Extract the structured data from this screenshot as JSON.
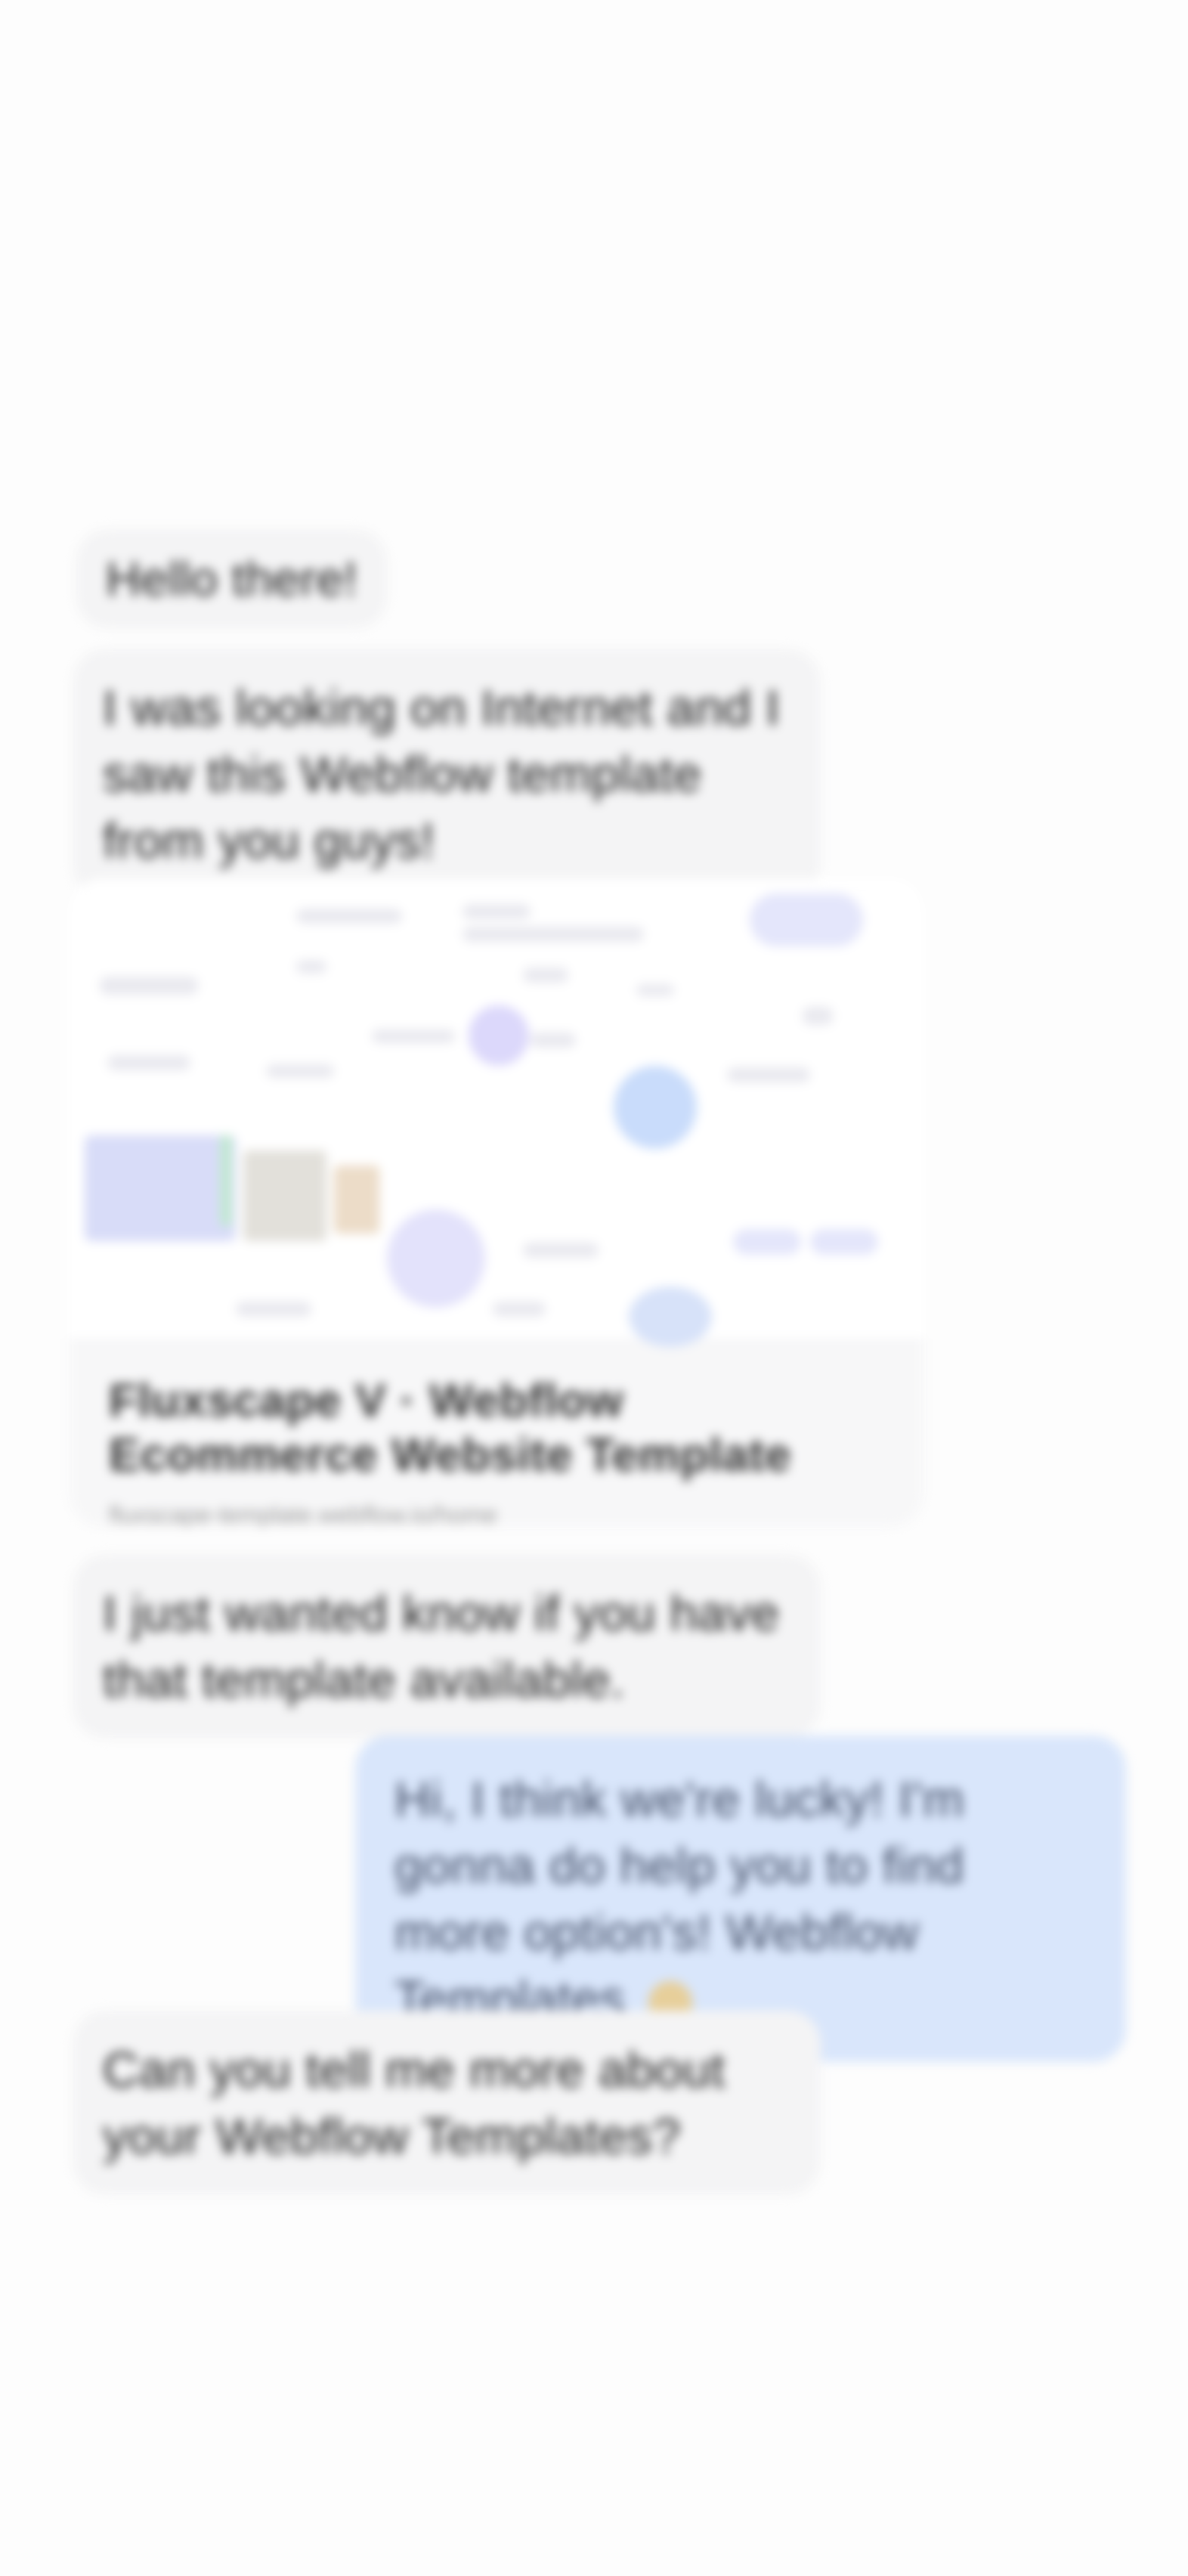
{
  "conversation": {
    "greeting": "Hello there!",
    "intro": "I was looking on Internet and I saw this Webflow template from you guys!",
    "link_card": {
      "title": "Fluxscape V · Webflow Ecommerce Website Template",
      "source": "fluxscape-template.webflow.io/home"
    },
    "follow_up": "I just wanted know if you have that template available.",
    "reply": "Hi, I think we're lucky! I'm gonna do help you to find more option's! Webflow Templates",
    "question": "Can you tell me more about your Webflow Templates?"
  },
  "colors": {
    "page_bg": "#fdfdfd",
    "incoming_bubble": "#f4f4f5",
    "outgoing_bubble": "#d9e6fb"
  }
}
